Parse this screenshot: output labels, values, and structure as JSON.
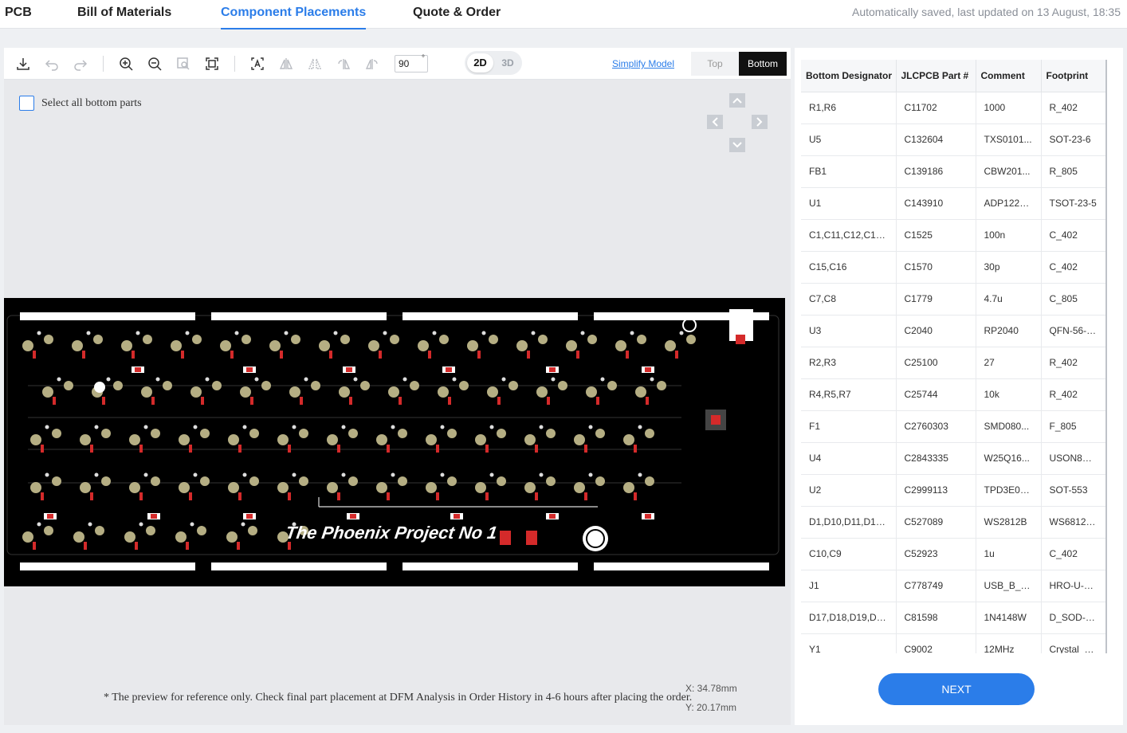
{
  "nav": {
    "tabs": [
      "PCB",
      "Bill of Materials",
      "Component Placements",
      "Quote & Order"
    ],
    "active_tab": "Component Placements",
    "autosave": "Automatically saved, last updated on 13 August, 18:35"
  },
  "toolbar": {
    "rotation_value": "90",
    "rotation_unit": "°",
    "view_2d": "2D",
    "view_3d": "3D",
    "simplify_model": "Simplify Model",
    "side_top": "Top",
    "side_bottom": "Bottom",
    "icons": [
      "download-icon",
      "undo-icon",
      "redo-icon",
      "zoom-in-icon",
      "zoom-out-icon",
      "zoom-area-icon",
      "fit-view-icon",
      "text-label-icon",
      "flip-horizontal-icon",
      "flip-vertical-icon",
      "rotate-left-icon",
      "rotate-right-icon"
    ]
  },
  "canvas": {
    "select_all_label": "Select all bottom parts",
    "board_text": "The Phoenix Project No 1",
    "footnote": "* The preview for reference only. Check final part placement at DFM Analysis in Order History in 4-6 hours after placing the order.",
    "coord_x": "X:  34.78mm",
    "coord_y": "Y:  20.17mm"
  },
  "table": {
    "columns": [
      "Bottom Designator",
      "JLCPCB Part #",
      "Comment",
      "Footprint"
    ],
    "rows": [
      [
        "R1,R6",
        "C11702",
        "1000",
        "R_402"
      ],
      [
        "U5",
        "C132604",
        "TXS0101...",
        "SOT-23-6"
      ],
      [
        "FB1",
        "C139186",
        "CBW201...",
        "R_805"
      ],
      [
        "U1",
        "C143910",
        "ADP122A...",
        "TSOT-23-5"
      ],
      [
        "C1,C11,C12,C13,...",
        "C1525",
        "100n",
        "C_402"
      ],
      [
        "C15,C16",
        "C1570",
        "30p",
        "C_402"
      ],
      [
        "C7,C8",
        "C1779",
        "4.7u",
        "C_805"
      ],
      [
        "U3",
        "C2040",
        "RP2040",
        "QFN-56-R..."
      ],
      [
        "R2,R3",
        "C25100",
        "27",
        "R_402"
      ],
      [
        "R4,R5,R7",
        "C25744",
        "10k",
        "R_402"
      ],
      [
        "F1",
        "C2760303",
        "SMD080...",
        "F_805"
      ],
      [
        "U4",
        "C2843335",
        "W25Q16...",
        "USON8_3..."
      ],
      [
        "U2",
        "C2999113",
        "TPD3E00...",
        "SOT-553"
      ],
      [
        "D1,D10,D11,D12,...",
        "C527089",
        "WS2812B",
        "WS6812_..."
      ],
      [
        "C10,C9",
        "C52923",
        "1u",
        "C_402"
      ],
      [
        "J1",
        "C778749",
        "USB_B_M...",
        "HRO-U-M..."
      ],
      [
        "D17,D18,D19,D2...",
        "C81598",
        "1N4148W",
        "D_SOD-1..."
      ],
      [
        "Y1",
        "C9002",
        "12MHz",
        "Crystal_S..."
      ]
    ]
  },
  "next_label": "NEXT",
  "colors": {
    "accent": "#2b7de9",
    "board": "#000000",
    "component": "#d42a2a",
    "pad": "#b5ae83"
  }
}
